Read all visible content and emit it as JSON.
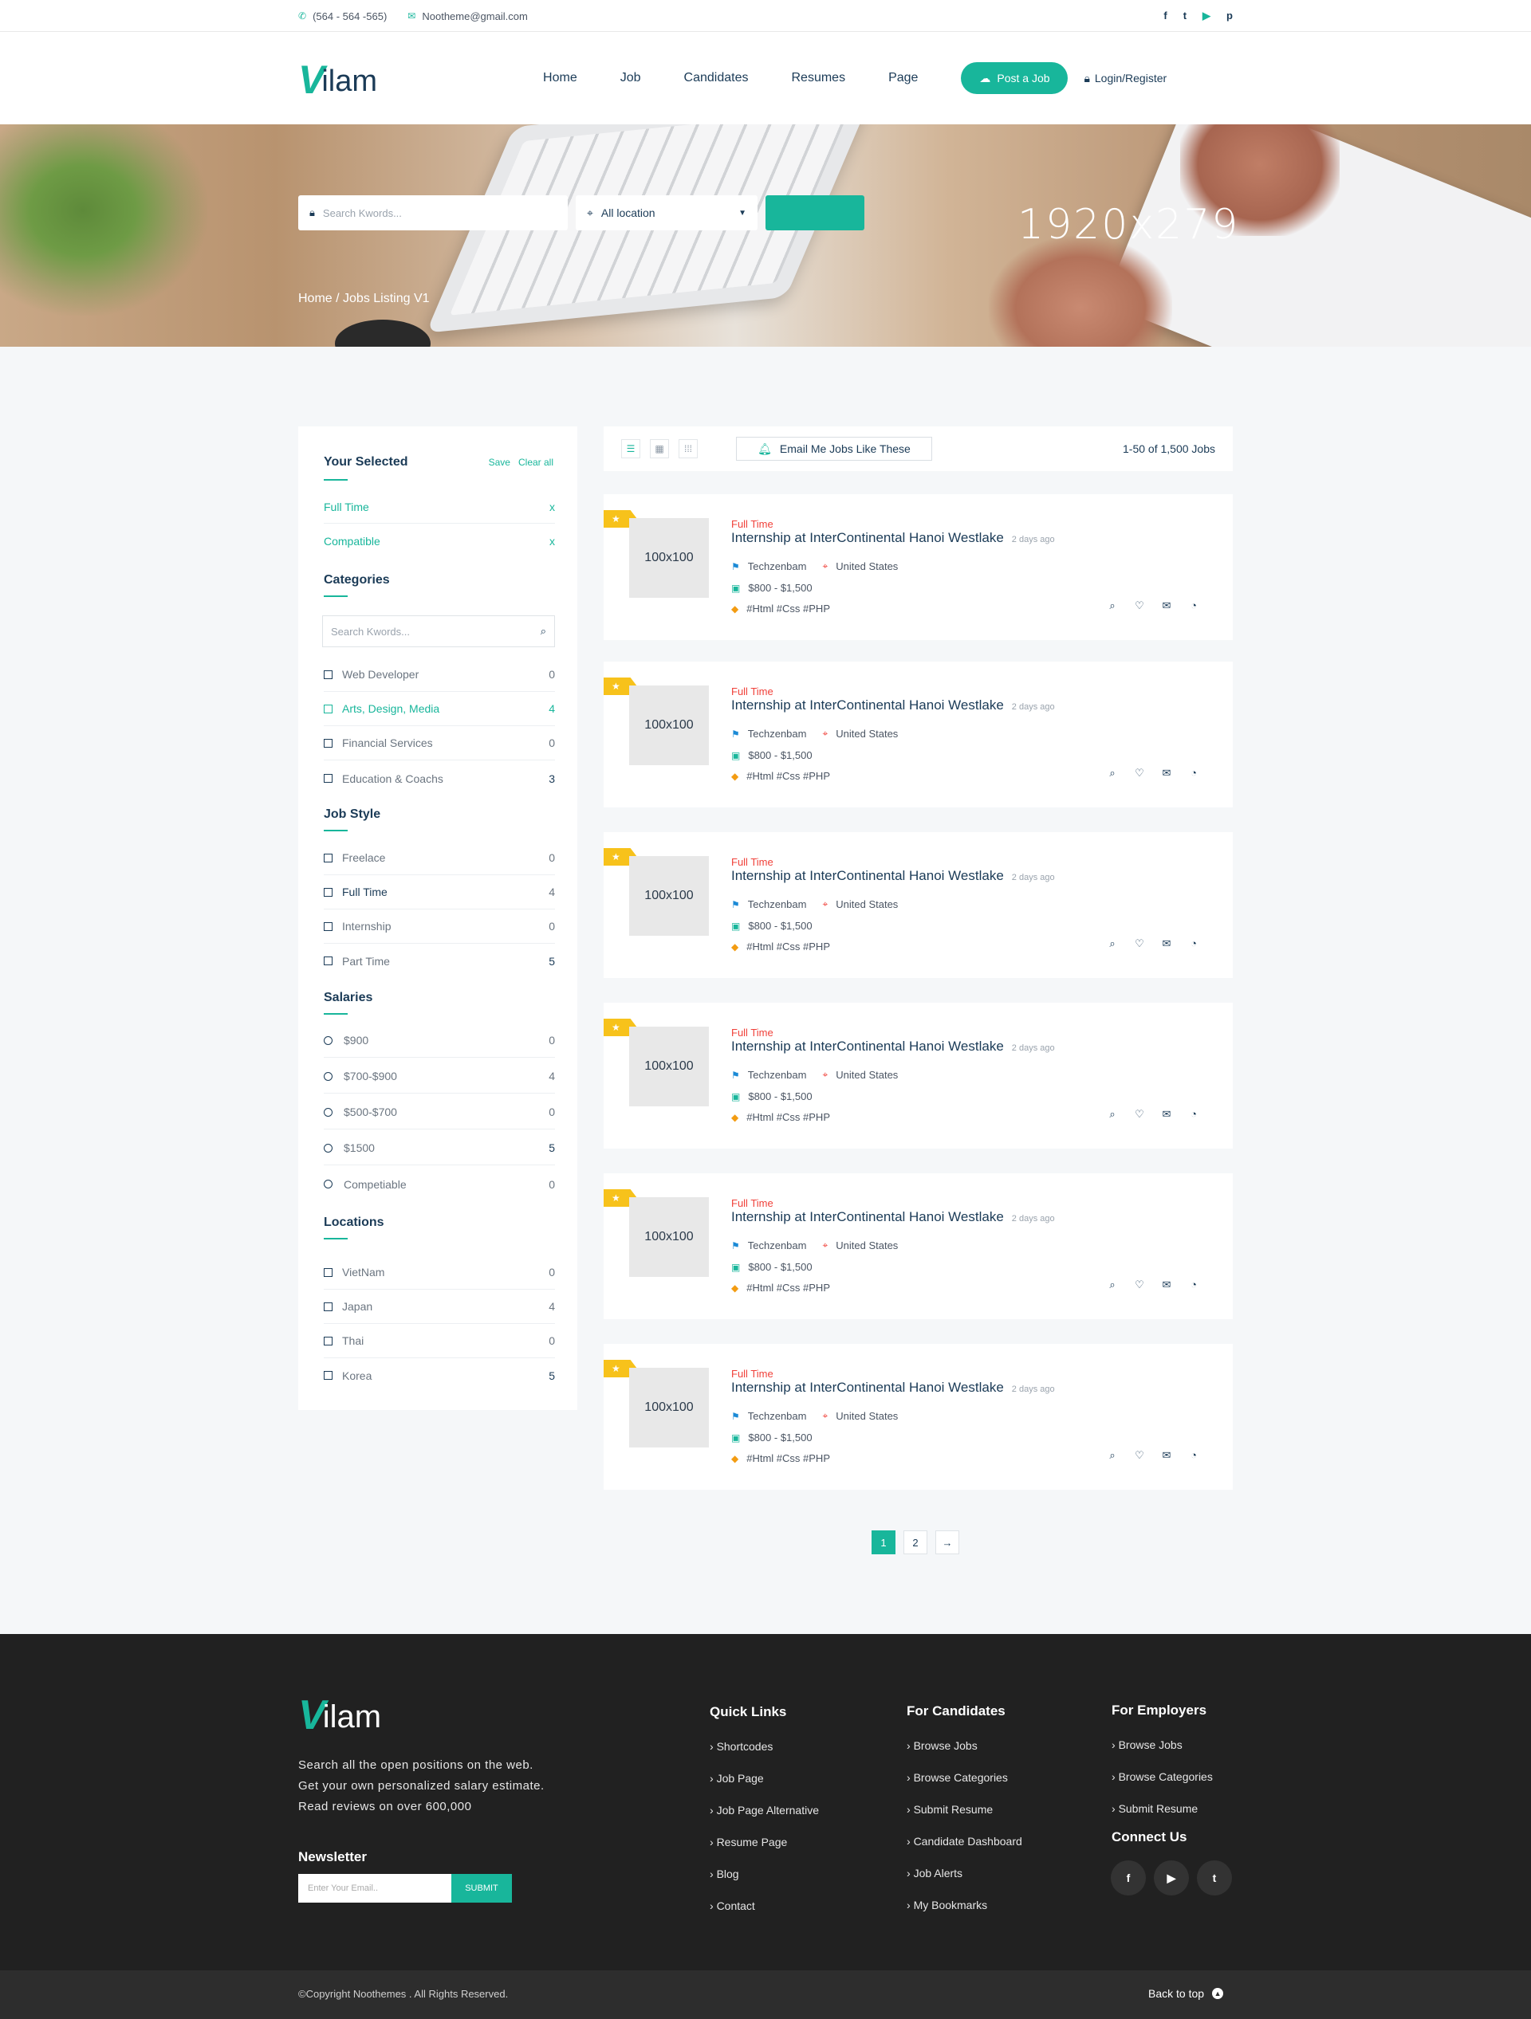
{
  "topbar": {
    "phone": "(564 - 564 -565)",
    "email": "Nootheme@gmail.com",
    "social": [
      "f",
      "t",
      "▶",
      "p"
    ]
  },
  "header": {
    "logo_v": "V",
    "logo_rest": "ilam",
    "nav": [
      "Home",
      "Job",
      "Candidates",
      "Resumes",
      "Page"
    ],
    "post_job": "Post a Job",
    "login": "Login/Register"
  },
  "hero": {
    "search_placeholder": "Search Kwords...",
    "location": "All location",
    "image_label": "1920x279",
    "breadcrumb": "Home / Jobs Listing V1"
  },
  "sidebar": {
    "selected_title": "Your Selected",
    "save": "Save",
    "clear_all": "Clear all",
    "selected": [
      {
        "label": "Full Time",
        "x": "x"
      },
      {
        "label": "Compatible",
        "x": "x"
      }
    ],
    "categories_title": "Categories",
    "search_placeholder": "Search Kwords...",
    "categories": [
      {
        "label": "Web Developer",
        "count": "0"
      },
      {
        "label": "Arts, Design, Media",
        "count": "4"
      },
      {
        "label": "Financial Services",
        "count": "0"
      },
      {
        "label": "Education & Coachs",
        "count": "3"
      }
    ],
    "jobstyle_title": "Job Style",
    "jobstyles": [
      {
        "label": "Freelace",
        "count": "0"
      },
      {
        "label": "Full Time",
        "count": "4"
      },
      {
        "label": "Internship",
        "count": "0"
      },
      {
        "label": "Part Time",
        "count": "5"
      }
    ],
    "salaries_title": "Salaries",
    "salaries": [
      {
        "label": "$900",
        "count": "0"
      },
      {
        "label": "$700-$900",
        "count": "4"
      },
      {
        "label": "$500-$700",
        "count": "0"
      },
      {
        "label": "$1500",
        "count": "5"
      },
      {
        "label": "Competiable",
        "count": "0"
      }
    ],
    "locations_title": "Locations",
    "locations": [
      {
        "label": "VietNam",
        "count": "0"
      },
      {
        "label": "Japan",
        "count": "4"
      },
      {
        "label": "Thai",
        "count": "0"
      },
      {
        "label": "Korea",
        "count": "5"
      }
    ]
  },
  "toolbar": {
    "email_alert": "Email Me Jobs Like These",
    "count": "1-50 of 1,500 Jobs"
  },
  "jobs": [
    {
      "thumb": "100x100",
      "type": "Full Time",
      "title": "Internship at InterContinental Hanoi Westlake",
      "ago": "2 days ago",
      "company": "Techzenbam",
      "location": "United States",
      "salary": "$800 - $1,500",
      "tags": "#Html #Css #PHP"
    },
    {
      "thumb": "100x100",
      "type": "Full Time",
      "title": "Internship at InterContinental Hanoi Westlake",
      "ago": "2 days ago",
      "company": "Techzenbam",
      "location": "United States",
      "salary": "$800 - $1,500",
      "tags": "#Html #Css #PHP"
    },
    {
      "thumb": "100x100",
      "type": "Full Time",
      "title": "Internship at InterContinental Hanoi Westlake",
      "ago": "2 days ago",
      "company": "Techzenbam",
      "location": "United States",
      "salary": "$800 - $1,500",
      "tags": "#Html #Css #PHP"
    },
    {
      "thumb": "100x100",
      "type": "Full Time",
      "title": "Internship at InterContinental Hanoi Westlake",
      "ago": "2 days ago",
      "company": "Techzenbam",
      "location": "United States",
      "salary": "$800 - $1,500",
      "tags": "#Html #Css #PHP"
    },
    {
      "thumb": "100x100",
      "type": "Full Time",
      "title": "Internship at InterContinental Hanoi Westlake",
      "ago": "2 days ago",
      "company": "Techzenbam",
      "location": "United States",
      "salary": "$800 - $1,500",
      "tags": "#Html #Css #PHP"
    },
    {
      "thumb": "100x100",
      "type": "Full Time",
      "title": "Internship at InterContinental Hanoi Westlake",
      "ago": "2 days ago",
      "company": "Techzenbam",
      "location": "United States",
      "salary": "$800 - $1,500",
      "tags": "#Html #Css #PHP"
    }
  ],
  "pagination": {
    "pages": [
      "1",
      "2"
    ],
    "next": "→"
  },
  "footer": {
    "logo_v": "V",
    "logo_rest": "ilam",
    "desc_lines": [
      "Search all the open positions on the web.",
      "Get your own personalized salary estimate.",
      "Read reviews on over 600,000"
    ],
    "newsletter_title": "Newsletter",
    "newsletter_placeholder": "Enter Your Email..",
    "submit": "SUBMIT",
    "quick_links_title": "Quick Links",
    "quick_links": [
      "Shortcodes",
      "Job Page",
      "Job Page Alternative",
      "Resume Page",
      "Blog",
      "Contact"
    ],
    "candidates_title": "For Candidates",
    "candidates": [
      "Browse Jobs",
      "Browse Categories",
      "Submit Resume",
      "Candidate Dashboard",
      "Job Alerts",
      "My Bookmarks"
    ],
    "employers_title": "For Employers",
    "employers": [
      "Browse Jobs",
      "Browse Categories",
      "Submit Resume"
    ],
    "connect_title": "Connect Us",
    "connect": [
      "f",
      "▶",
      "t"
    ],
    "copyright": "©Copyright Noothemes . All Rights Reserved.",
    "back_to_top": "Back to top"
  },
  "colors": {
    "accent": "#18b69b",
    "dark": "#1b3b57",
    "ribbon": "#f7c21b",
    "type": "#f0413a",
    "footer": "#212121"
  }
}
